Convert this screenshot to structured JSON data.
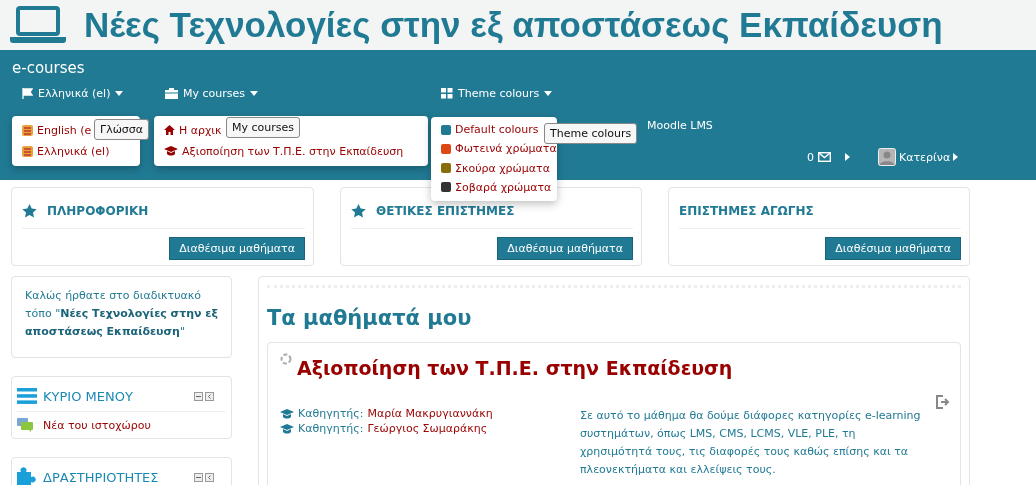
{
  "site_title": "Νέες Τεχνολογίες στην εξ αποστάσεως Εκπαίδευση",
  "brand": "e-courses",
  "nav": [
    {
      "kind": "flag",
      "label": "Ελληνικά (el)"
    },
    {
      "kind": "briefcase",
      "label": "My courses"
    },
    {
      "kind": "grid",
      "label": "Theme colours"
    }
  ],
  "nav_link": "Moodle LMS",
  "messages": {
    "count": "0"
  },
  "user": {
    "name": "Κατερίνα"
  },
  "language_menu": {
    "items": [
      "English (e",
      "Ελληνικά (el)"
    ],
    "tooltip": "Γλώσσα"
  },
  "courses_menu": {
    "items": [
      {
        "kind": "home",
        "label": "Η αρχικ"
      },
      {
        "kind": "course",
        "label": "Αξιοποίηση των Τ.Π.Ε. στην Εκπαίδευση"
      }
    ],
    "tooltip": "My courses"
  },
  "theme_menu": {
    "items": [
      {
        "label": "Default colours",
        "color": "#217a94"
      },
      {
        "label": "Φωτεινά χρώματα",
        "color": "#dd4814"
      },
      {
        "label": "Σκούρα χρώματα",
        "color": "#8a6d0b"
      },
      {
        "label": "Σοβαρά χρώματα",
        "color": "#333333"
      }
    ],
    "tooltip": "Theme colours"
  },
  "categories": [
    {
      "kind": "starred",
      "title": "ΠΛΗΡΟΦΟΡΙΚΗ",
      "button": "Διαθέσιμα μαθήματα"
    },
    {
      "kind": "starred",
      "title": "ΘΕΤΙΚΕΣ ΕΠΙΣΤΗΜΕΣ",
      "button": "Διαθέσιμα μαθήματα"
    },
    {
      "kind": "plain",
      "title": "ΕΠΙΣΤΗΜΕΣ ΑΓΩΓΗΣ",
      "button": "Διαθέσιμα μαθήματα"
    }
  ],
  "welcome": "Καλώς ήρθατε στο διαδικτυακό τόπο \"**Νέες Τεχνολογίες στην εξ αποστάσεως Εκπαίδευση**\"",
  "blocks": [
    {
      "kind": "menu",
      "title": "ΚΥΡΙΟ ΜΕΝΟΥ",
      "items": [
        "Νέα του ιστοχώρου"
      ]
    },
    {
      "kind": "activities",
      "title": "ΔΡΑΣΤΗΡΙΟΤΗΤΕΣ"
    }
  ],
  "my_courses": {
    "heading": "Τα μαθήματά μου",
    "courses": [
      {
        "title": "Αξιοποίηση των Τ.Π.Ε. στην Εκπαίδευση",
        "teachers": [
          {
            "role": "Καθηγητής:",
            "name": "Μαρία Μακρυγιαννάκη"
          },
          {
            "role": "Καθηγητής:",
            "name": "Γεώργιος Σωμαράκης"
          }
        ],
        "summary": "Σε αυτό το μάθημα θα δούμε διάφορες κατηγορίες e-learning συστημάτων, όπως LMS, CMS, LCMS, VLE, PLE, τη χρησιμότητά τους, τις διαφορές τους καθώς επίσης και τα πλεονεκτήματα και ελλείψεις τους."
      }
    ]
  }
}
